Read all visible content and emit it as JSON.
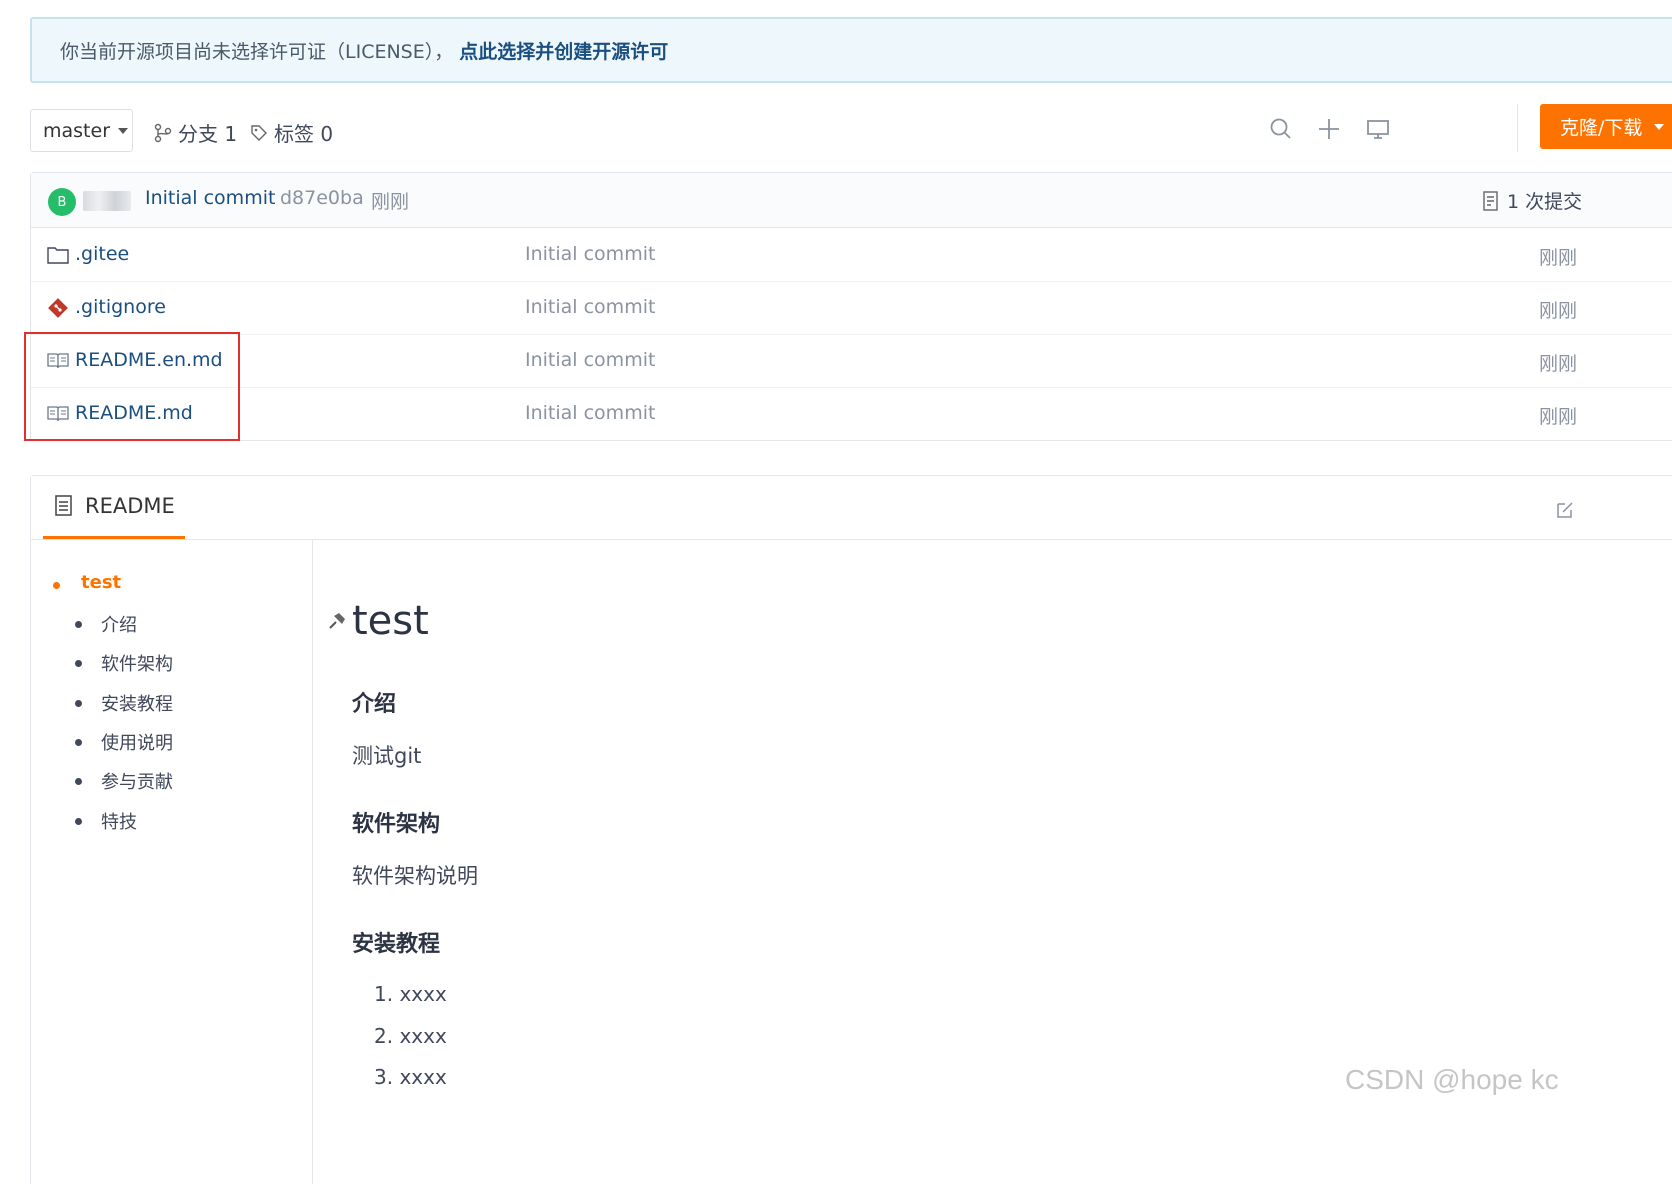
{
  "license_banner": {
    "message": "你当前开源项目尚未选择许可证（LICENSE），",
    "link": "点此选择并创建开源许可"
  },
  "toolbar": {
    "branch": "master",
    "branches_label": "分支 1",
    "tags_label": "标签 0",
    "clone_label": "克隆/下载"
  },
  "commit_header": {
    "avatar_letter": "B",
    "message": "Initial commit",
    "hash": "d87e0ba",
    "time": "刚刚",
    "count_label": "1 次提交"
  },
  "files": [
    {
      "name": ".gitee",
      "icon": "folder-icon",
      "message": "Initial commit",
      "time": "刚刚"
    },
    {
      "name": ".gitignore",
      "icon": "git-file-icon",
      "message": "Initial commit",
      "time": "刚刚"
    },
    {
      "name": "README.en.md",
      "icon": "book-icon",
      "message": "Initial commit",
      "time": "刚刚"
    },
    {
      "name": "README.md",
      "icon": "book-icon",
      "message": "Initial commit",
      "time": "刚刚"
    }
  ],
  "readme": {
    "tab_label": "README",
    "toc": [
      {
        "label": "test"
      },
      {
        "label": "介绍"
      },
      {
        "label": "软件架构"
      },
      {
        "label": "安装教程"
      },
      {
        "label": "使用说明"
      },
      {
        "label": "参与贡献"
      },
      {
        "label": "特技"
      }
    ],
    "title": "test",
    "sections": [
      {
        "heading": "介绍",
        "text": "测试git"
      },
      {
        "heading": "软件架构",
        "text": "软件架构说明"
      },
      {
        "heading": "安装教程"
      }
    ],
    "install_steps": [
      "1. xxxx",
      "2. xxxx",
      "3. xxxx"
    ]
  },
  "watermark": "CSDN @hope kc",
  "colors": {
    "accent": "#fe7300",
    "link": "#1b4f80",
    "highlight": "#e0302b",
    "avatar": "#26bd6a"
  }
}
